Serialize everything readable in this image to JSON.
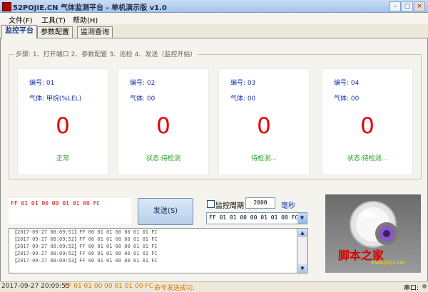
{
  "window": {
    "title": "52POJIE.CN 气体监测平台 - 单机演示版 v1.0",
    "minimize": "–",
    "maximize": "□",
    "close": "×"
  },
  "menu": {
    "file": "文件(F)",
    "tools": "工具(T)",
    "help": "帮助(H)"
  },
  "tabs": [
    "监控平台",
    "参数配置",
    "监测查询"
  ],
  "steps_label": "步骤: 1、打开端口 2、参数配置 3、巡检 4、发送（监控开始）",
  "cards": [
    {
      "num": "编号: 01",
      "gas": "气体: 甲烷(%LEL)",
      "value": "0",
      "status": "正常"
    },
    {
      "num": "编号: 02",
      "gas": "气体: 00",
      "value": "0",
      "status": "状态:待检测"
    },
    {
      "num": "编号: 03",
      "gas": "气体: 00",
      "value": "0",
      "status": "待检测..."
    },
    {
      "num": "编号: 04",
      "gas": "气体: 00",
      "value": "0",
      "status": "状态:待检测..."
    }
  ],
  "command": {
    "text": "FF 01 01 00 00 01 01 00 FC",
    "send_label": "发送(S)",
    "period_label": "监控周期",
    "period_value": "2000",
    "period_unit": "毫秒",
    "select_value": "FF 01 01 00 00 01 01 00 FC",
    "period_checked": false
  },
  "log": [
    "【2017-09-27 08:09:51】FF 00 01 01 00 00 01 01 FC",
    "【2017-09-27 08:09:52】FF 00 01 01 00 00 01 01 FC",
    "【2017-09-27 08:09:52】FF 00 01 01 00 00 01 01 FC",
    "【2017-09-27 08:09:52】FF 00 01 01 00 00 01 01 FC",
    "【2017-09-27 08:09:53】FF 00 01 01 00 00 01 01 FC"
  ],
  "logo": {
    "text": "脚本之家",
    "sub": "www.jb51.net"
  },
  "status": {
    "time": "2017-09-27 20:09:55",
    "cmd": "FF 01 01 00 00 01 01 00 FC",
    "message": "命令发送成功.",
    "port_label": "串口:"
  },
  "colors": {
    "value_red": "#e80000",
    "label_blue": "#1a34b0",
    "status_green": "#1aa01a",
    "status_orange": "#e07000"
  }
}
